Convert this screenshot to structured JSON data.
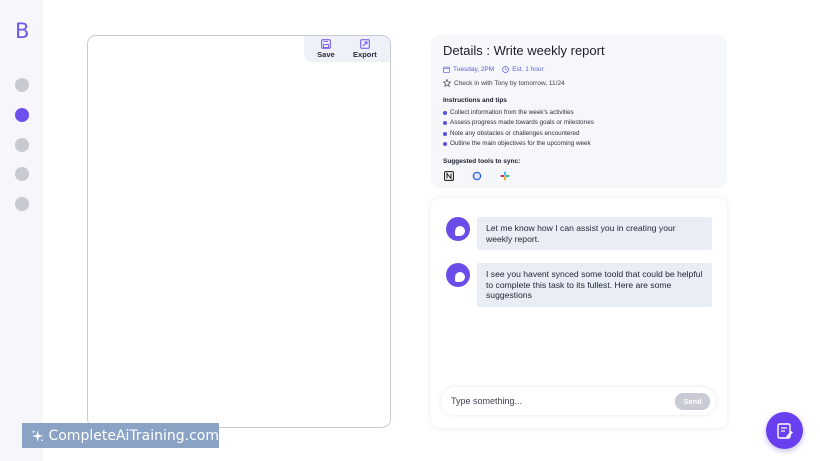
{
  "sidebar": {
    "logo": "B",
    "nav": [
      {
        "name": "nav-item-1",
        "active": false
      },
      {
        "name": "nav-item-2",
        "active": true
      },
      {
        "name": "nav-item-3",
        "active": false
      },
      {
        "name": "nav-item-4",
        "active": false
      },
      {
        "name": "nav-item-5",
        "active": false
      }
    ],
    "accent_color": "#6d4fee"
  },
  "canvas": {
    "toolbar": {
      "save_label": "Save",
      "save_icon": "save-icon",
      "export_label": "Export",
      "export_icon": "export-icon"
    }
  },
  "details": {
    "title": "Details : Write weekly report",
    "date": "Tuesday, 2PM",
    "estimate": "Est. 1 hour",
    "checkin": "Check in with Tony by tomorrow, 11/24",
    "instructions_title": "Instructions and tips",
    "tips": [
      "Collect information from the week's activities",
      "Assess progress made towards goals or milestones",
      "Note any obstacles or challenges encountered",
      "Outline the main objectives for the upcoming week"
    ],
    "tools_title": "Suggested tools to sync:",
    "tools": [
      "notion-icon",
      "circle-app-icon",
      "slack-icon"
    ]
  },
  "chat": {
    "messages": [
      "Let me know how I can assist you in creating your weekly report.",
      "I see you havent synced some toold that could be helpful to complete this task to its fullest. Here are some suggestions"
    ],
    "input_placeholder": "Type something...",
    "send_label": "Send"
  },
  "watermark": {
    "text": "CompleteAiTraining.com"
  },
  "fab": {
    "icon": "edit-note-icon"
  }
}
